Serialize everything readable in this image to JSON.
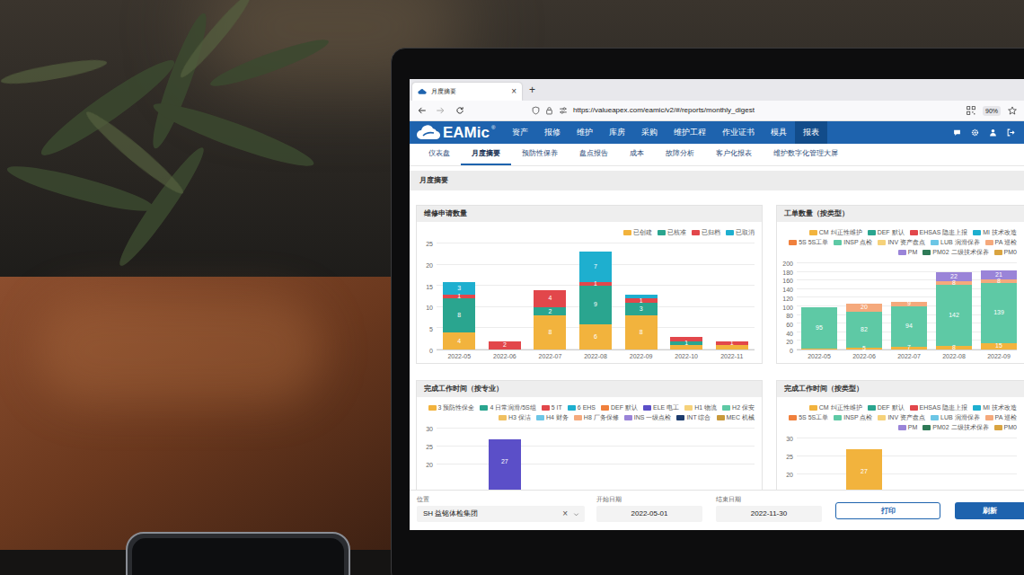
{
  "browser": {
    "tabs": [
      {
        "title": "月度摘要",
        "close": "×",
        "selected": true
      }
    ],
    "new_tab": "+",
    "url": "https://valueapex.com/eamic/v2/#/reports/monthly_digest",
    "zoom": "90%"
  },
  "app": {
    "logo": "EAMic",
    "logo_mark": "®",
    "menu": [
      {
        "label": "资产",
        "selected": false
      },
      {
        "label": "报修",
        "selected": false
      },
      {
        "label": "维护",
        "selected": false
      },
      {
        "label": "库房",
        "selected": false
      },
      {
        "label": "采购",
        "selected": false
      },
      {
        "label": "维护工程",
        "selected": false
      },
      {
        "label": "作业证书",
        "selected": false
      },
      {
        "label": "模具",
        "selected": false
      },
      {
        "label": "报表",
        "selected": true
      }
    ],
    "submenu": [
      {
        "label": "仪表盘",
        "selected": false
      },
      {
        "label": "月度摘要",
        "selected": true
      },
      {
        "label": "预防性保养",
        "selected": false
      },
      {
        "label": "盘点报告",
        "selected": false
      },
      {
        "label": "成本",
        "selected": false
      },
      {
        "label": "故障分析",
        "selected": false
      },
      {
        "label": "客户化报表",
        "selected": false
      },
      {
        "label": "维护数字化管理大屏",
        "selected": false
      }
    ]
  },
  "page_title": "月度摘要",
  "charts": [
    {
      "title": "维修申请数量",
      "y_ticks": [
        "0",
        "5",
        "10",
        "15",
        "20",
        "25"
      ],
      "x_labels": [
        "2022-05",
        "2022-06",
        "2022-07",
        "2022-08",
        "2022-09",
        "2022-10",
        "2022-11"
      ],
      "legend": [
        {
          "label": "已创建",
          "color": "#f2b33d",
          "values": [
            4,
            0,
            8,
            6,
            8,
            1,
            1
          ],
          "labels": [
            "4",
            "",
            "8",
            "6",
            "8",
            "",
            ""
          ]
        },
        {
          "label": "已核准",
          "color": "#2aa58f",
          "values": [
            8,
            0,
            2,
            9,
            3,
            1,
            0
          ],
          "labels": [
            "8",
            "",
            "2",
            "9",
            "3",
            "1",
            ""
          ]
        },
        {
          "label": "已归档",
          "color": "#e2474b",
          "values": [
            1,
            2,
            4,
            1,
            1,
            1,
            1
          ],
          "labels": [
            "1",
            "2",
            "4",
            "1",
            "1",
            "",
            "1"
          ]
        },
        {
          "label": "已取消",
          "color": "#1eafcf",
          "values": [
            3,
            0,
            0,
            7,
            1,
            0,
            0
          ],
          "labels": [
            "3",
            "",
            "",
            "7",
            "",
            "",
            ""
          ]
        }
      ]
    },
    {
      "title": "工单数量（按类型）",
      "y_ticks": [
        "0",
        "20",
        "40",
        "60",
        "80",
        "100",
        "120",
        "140",
        "160",
        "180",
        "200"
      ],
      "x_labels": [
        "2022-05",
        "2022-06",
        "2022-07",
        "2022-08",
        "2022-09"
      ],
      "legend": [
        {
          "label": "CM 纠正性维护",
          "color": "#f2b33d",
          "values": [
            3,
            5,
            7,
            8,
            15
          ],
          "labels": [
            "",
            "5",
            "7",
            "8",
            "15"
          ]
        },
        {
          "label": "DEF 默认",
          "color": "#2aa58f"
        },
        {
          "label": "EHSAS 隐患上报",
          "color": "#e2474b"
        },
        {
          "label": "MI 技术改造",
          "color": "#1eafcf"
        },
        {
          "label": "5S 5S工单",
          "color": "#f0803c"
        },
        {
          "label": "INSP 点检",
          "color": "#5ec9a5",
          "values": [
            95,
            82,
            94,
            142,
            139
          ],
          "labels": [
            "95",
            "82",
            "94",
            "142",
            "139"
          ]
        },
        {
          "label": "INV 资产盘点",
          "color": "#f6d27a"
        },
        {
          "label": "LUB 润滑保养",
          "color": "#6cc6e6"
        },
        {
          "label": "PA 巡检",
          "color": "#f5a97c",
          "values": [
            0,
            20,
            9,
            8,
            8
          ],
          "labels": [
            "",
            "20",
            "9",
            "8",
            "8"
          ]
        },
        {
          "label": "PM",
          "color": "#9a84d8",
          "values": [
            0,
            0,
            0,
            22,
            21
          ],
          "labels": [
            "",
            "",
            "",
            "22",
            "21"
          ]
        },
        {
          "label": "PM02 二级技术保养",
          "color": "#2e7a57"
        },
        {
          "label": "PM0",
          "color": "#d9a441"
        }
      ]
    },
    {
      "title": "完成工作时间（按专业）",
      "y_ticks": [
        "20",
        "25",
        "30"
      ],
      "legend": [
        {
          "label": "3 预防性保全",
          "color": "#f2b33d"
        },
        {
          "label": "4 日常润滑/5S组",
          "color": "#2aa58f"
        },
        {
          "label": "5 IT",
          "color": "#e2474b"
        },
        {
          "label": "6 EHS",
          "color": "#1eafcf"
        },
        {
          "label": "DEF 默认",
          "color": "#f0803c"
        },
        {
          "label": "ELE 电工",
          "color": "#5b4fc8",
          "values": [
            0,
            27,
            0,
            0,
            0,
            0,
            0
          ],
          "labels": [
            "",
            "27",
            "",
            "",
            "",
            "",
            ""
          ]
        },
        {
          "label": "H1 物流",
          "color": "#f6d27a"
        },
        {
          "label": "H2 保安",
          "color": "#5ec9a5"
        },
        {
          "label": "H3 保洁",
          "color": "#f0c060"
        },
        {
          "label": "H4 财务",
          "color": "#6cc6e6"
        },
        {
          "label": "H8 厂务保修",
          "color": "#f5a97c"
        },
        {
          "label": "INS 一级点检",
          "color": "#9a84d8"
        },
        {
          "label": "INT 综合",
          "color": "#1d3c6e"
        },
        {
          "label": "MEC 机械",
          "color": "#c89a3c"
        }
      ]
    },
    {
      "title": "完成工作时间（按类型）",
      "y_ticks": [
        "20",
        "25",
        "30"
      ],
      "legend": [
        {
          "label": "CM 纠正性维护",
          "color": "#f2b33d",
          "values": [
            0,
            27,
            0,
            0,
            0
          ],
          "labels": [
            "",
            "27",
            "",
            "",
            ""
          ]
        },
        {
          "label": "DEF 默认",
          "color": "#2aa58f"
        },
        {
          "label": "EHSAS 隐患上报",
          "color": "#e2474b"
        },
        {
          "label": "MI 技术改造",
          "color": "#1eafcf"
        },
        {
          "label": "5S 5S工单",
          "color": "#f0803c"
        },
        {
          "label": "INSP 点检",
          "color": "#5ec9a5"
        },
        {
          "label": "INV 资产盘点",
          "color": "#f6d27a"
        },
        {
          "label": "LUB 润滑保养",
          "color": "#6cc6e6"
        },
        {
          "label": "PA 巡检",
          "color": "#f5a97c"
        },
        {
          "label": "PM",
          "color": "#9a84d8"
        },
        {
          "label": "PM02 二级技术保养",
          "color": "#2e7a57"
        },
        {
          "label": "PM0",
          "color": "#d9a441"
        }
      ]
    }
  ],
  "filters": {
    "location": {
      "label": "位置",
      "value": "SH 益铭体检集团",
      "clear": "×"
    },
    "start_date": {
      "label": "开始日期",
      "value": "2022-05-01"
    },
    "end_date": {
      "label": "结束日期",
      "value": "2022-11-30"
    }
  },
  "buttons": [
    {
      "label": "打印",
      "kind": "outline"
    },
    {
      "label": "刷新",
      "kind": "primary"
    }
  ]
}
